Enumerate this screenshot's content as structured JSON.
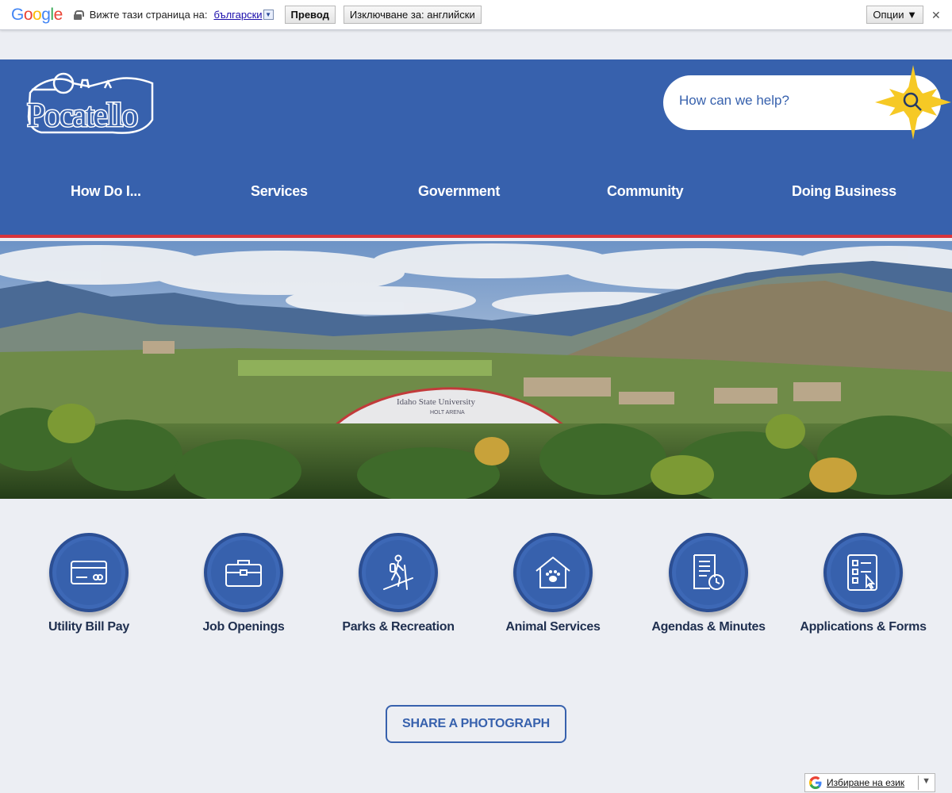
{
  "translate_bar": {
    "logo": [
      "G",
      "o",
      "o",
      "g",
      "l",
      "e"
    ],
    "logo_colors": [
      "#4285f4",
      "#ea4335",
      "#fbbc05",
      "#4285f4",
      "#34a853",
      "#ea4335"
    ],
    "view_page_in": "Вижте тази страница на:",
    "language": "български",
    "translate_button": "Превод",
    "turn_off_button": "Изключване за: английски",
    "options_button": "Опции ▼",
    "close": "✕"
  },
  "header": {
    "logo_text": "Pocatello",
    "search_placeholder": "How can we help?",
    "nav": [
      "How Do I...",
      "Services",
      "Government",
      "Community",
      "Doing Business"
    ],
    "colors": {
      "primary": "#3761ad",
      "accent_line": "#d8343c",
      "star": "#f6c925"
    }
  },
  "hero": {
    "arena_title": "Idaho State University",
    "arena_subtitle": "HOLT ARENA"
  },
  "quick_links": [
    {
      "label": "Utility Bill Pay",
      "icon": "credit-card-icon"
    },
    {
      "label": "Job Openings",
      "icon": "briefcase-icon"
    },
    {
      "label": "Parks & Recreation",
      "icon": "hiker-icon"
    },
    {
      "label": "Animal Services",
      "icon": "pet-house-icon"
    },
    {
      "label": "Agendas & Minutes",
      "icon": "document-clock-icon"
    },
    {
      "label": "Applications & Forms",
      "icon": "form-checklist-icon"
    }
  ],
  "share_button": "SHARE A PHOTOGRAPH",
  "language_selector": {
    "label": "Избиране на език",
    "arrow": "▼"
  }
}
